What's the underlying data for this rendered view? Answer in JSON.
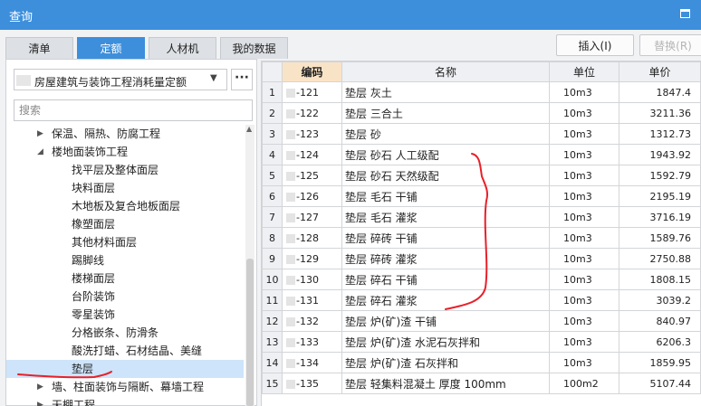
{
  "window": {
    "title": "查询"
  },
  "tabs": [
    {
      "label": "清单",
      "active": false
    },
    {
      "label": "定额",
      "active": true
    },
    {
      "label": "人材机",
      "active": false
    },
    {
      "label": "我的数据",
      "active": false
    }
  ],
  "actions": {
    "insert_label": "插入(I)",
    "replace_label": "替换(R)"
  },
  "library": {
    "selected": "房屋建筑与装饰工程消耗量定额",
    "more_label": "···"
  },
  "search": {
    "placeholder": "搜索",
    "value": ""
  },
  "tree": [
    {
      "label": "保温、隔热、防腐工程",
      "level": 1,
      "expanded": false
    },
    {
      "label": "楼地面装饰工程",
      "level": 1,
      "expanded": true
    },
    {
      "label": "找平层及整体面层",
      "level": 2
    },
    {
      "label": "块料面层",
      "level": 2
    },
    {
      "label": "木地板及复合地板面层",
      "level": 2
    },
    {
      "label": "橡塑面层",
      "level": 2
    },
    {
      "label": "其他材料面层",
      "level": 2
    },
    {
      "label": "踢脚线",
      "level": 2
    },
    {
      "label": "楼梯面层",
      "level": 2
    },
    {
      "label": "台阶装饰",
      "level": 2
    },
    {
      "label": "零星装饰",
      "level": 2
    },
    {
      "label": "分格嵌条、防滑条",
      "level": 2
    },
    {
      "label": "酸洗打蜡、石材结晶、美缝",
      "level": 2
    },
    {
      "label": "垫层",
      "level": 2,
      "selected": true
    },
    {
      "label": "墙、柱面装饰与隔断、幕墙工程",
      "level": 1,
      "expanded": false
    },
    {
      "label": "天棚工程",
      "level": 1,
      "expanded": false
    }
  ],
  "table": {
    "headers": {
      "code": "编码",
      "name": "名称",
      "unit": "单位",
      "price": "单价"
    },
    "rows": [
      {
        "idx": "1",
        "code": "-121",
        "name": "垫层 灰土",
        "unit": "10m3",
        "price": "1847.4"
      },
      {
        "idx": "2",
        "code": "-122",
        "name": "垫层 三合土",
        "unit": "10m3",
        "price": "3211.36"
      },
      {
        "idx": "3",
        "code": "-123",
        "name": "垫层 砂",
        "unit": "10m3",
        "price": "1312.73"
      },
      {
        "idx": "4",
        "code": "-124",
        "name": "垫层 砂石 人工级配",
        "unit": "10m3",
        "price": "1943.92"
      },
      {
        "idx": "5",
        "code": "-125",
        "name": "垫层 砂石 天然级配",
        "unit": "10m3",
        "price": "1592.79"
      },
      {
        "idx": "6",
        "code": "-126",
        "name": "垫层 毛石 干铺",
        "unit": "10m3",
        "price": "2195.19"
      },
      {
        "idx": "7",
        "code": "-127",
        "name": "垫层 毛石 灌浆",
        "unit": "10m3",
        "price": "3716.19"
      },
      {
        "idx": "8",
        "code": "-128",
        "name": "垫层 碎砖 干铺",
        "unit": "10m3",
        "price": "1589.76"
      },
      {
        "idx": "9",
        "code": "-129",
        "name": "垫层 碎砖 灌浆",
        "unit": "10m3",
        "price": "2750.88"
      },
      {
        "idx": "10",
        "code": "-130",
        "name": "垫层 碎石 干铺",
        "unit": "10m3",
        "price": "1808.15"
      },
      {
        "idx": "11",
        "code": "-131",
        "name": "垫层 碎石 灌浆",
        "unit": "10m3",
        "price": "3039.2"
      },
      {
        "idx": "12",
        "code": "-132",
        "name": "垫层 炉(矿)渣 干铺",
        "unit": "10m3",
        "price": "840.97"
      },
      {
        "idx": "13",
        "code": "-133",
        "name": "垫层 炉(矿)渣 水泥石灰拌和",
        "unit": "10m3",
        "price": "6206.3"
      },
      {
        "idx": "14",
        "code": "-134",
        "name": "垫层 炉(矿)渣 石灰拌和",
        "unit": "10m3",
        "price": "1859.95"
      },
      {
        "idx": "15",
        "code": "-135",
        "name": "垫层 轻集料混凝土 厚度 100mm",
        "unit": "100m2",
        "price": "5107.44"
      }
    ]
  },
  "colors": {
    "accent": "#3d8fdc",
    "selected_row": "#cde4fa",
    "code_header": "#f9e3c6",
    "annotation": "#e8202a"
  },
  "icons": {
    "maximize": "maximize-icon",
    "dropdown": "chevron-down-icon",
    "expand": "triangle-right-icon",
    "collapse": "triangle-down-icon"
  }
}
